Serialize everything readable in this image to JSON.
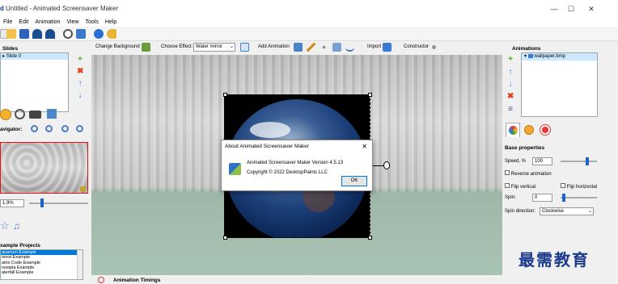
{
  "window": {
    "title": "Untitled - Animated Screensaver Maker",
    "icon_letter": "d",
    "minimize": "—",
    "maximize": "☐",
    "close": "✕"
  },
  "menu": [
    "File",
    "Edit",
    "Animation",
    "View",
    "Tools",
    "Help"
  ],
  "effect_bar": {
    "change_background": "Change Background",
    "choose_effect_label": "Choose Effect:",
    "choose_effect_value": "Water mirror",
    "add_animation": "Add Animation",
    "import": "Import",
    "constructor": "Constructor"
  },
  "left": {
    "slides_header": "Slides",
    "slides": [
      "Slide 0"
    ],
    "navigator_label": "avigator:",
    "zoom_value": "1.9%",
    "example_header": "xample Projects",
    "examples": [
      "quarium Example",
      "orest Example",
      "atrix Code Example",
      "nowpia Example",
      "aterfall Example"
    ]
  },
  "dialog": {
    "title": "About Animated Screensaver Maker",
    "close": "✕",
    "version": "Animated Screensaver Maker Version 4.5.13",
    "copyright": "Copyright © 2022 DesktopPaints LLC",
    "ok": "OK"
  },
  "bottom": {
    "timings_label": "Animation Timings"
  },
  "right": {
    "animations_header": "Animations",
    "tree_item": "wallpaper.bmp",
    "base_properties": "Base properties",
    "speed_label": "Speed, %",
    "speed_value": "100",
    "speed_level": 0.75,
    "reverse_label": "Reverse animation",
    "flip_vertical": "Flip vertical",
    "flip_horizontal": "Flip horizontal",
    "spin_label": "Spin:",
    "spin_value": "0",
    "spin_direction_label": "Spin direction:",
    "spin_direction_value": "Clockwise"
  },
  "watermark": "最需教育",
  "colors": {
    "accent": "#0078d7",
    "selection": "#cce8ff",
    "add_green": "#4caf1e",
    "delete_red": "#e0401a",
    "arrow_blue": "#2a7be4"
  }
}
